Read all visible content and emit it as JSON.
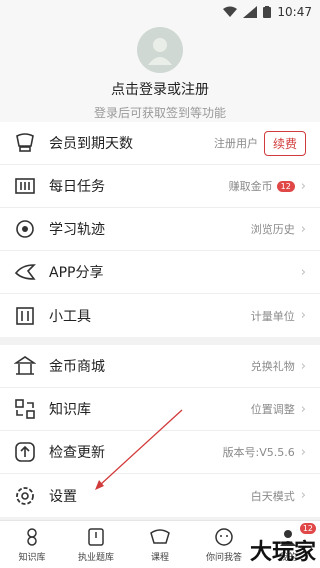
{
  "status": {
    "time": "10:47"
  },
  "header": {
    "title": "点击登录或注册",
    "subtitle": "登录后可获取签到等功能"
  },
  "group1": [
    {
      "icon": "crown-icon",
      "label": "会员到期天数",
      "right": "注册用户",
      "button": "续费"
    },
    {
      "icon": "task-icon",
      "label": "每日任务",
      "right": "赚取金币",
      "badge": "12"
    },
    {
      "icon": "track-icon",
      "label": "学习轨迹",
      "right": "浏览历史"
    },
    {
      "icon": "share-icon",
      "label": "APP分享",
      "right": ""
    },
    {
      "icon": "tools-icon",
      "label": "小工具",
      "right": "计量单位"
    }
  ],
  "group2": [
    {
      "icon": "shop-icon",
      "label": "金币商城",
      "right": "兑换礼物"
    },
    {
      "icon": "library-icon",
      "label": "知识库",
      "right": "位置调整"
    },
    {
      "icon": "update-icon",
      "label": "检查更新",
      "right": "版本号:V5.5.6"
    },
    {
      "icon": "settings-icon",
      "label": "设置",
      "right": "白天模式"
    }
  ],
  "tabs": [
    {
      "icon": "knowledge-icon",
      "label": "知识库"
    },
    {
      "icon": "exam-icon",
      "label": "执业题库"
    },
    {
      "icon": "course-icon",
      "label": "课程"
    },
    {
      "icon": "ask-icon",
      "label": "你问我答"
    },
    {
      "icon": "profile-icon",
      "label": "我的",
      "badge": "12"
    }
  ],
  "watermark": "大玩家",
  "colors": {
    "accent": "#d23b3b"
  }
}
